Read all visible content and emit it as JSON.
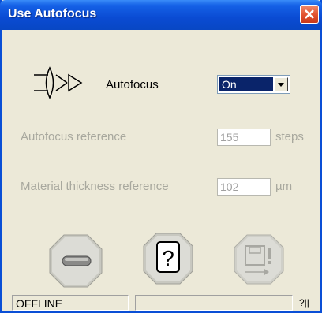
{
  "window": {
    "title": "Use Autofocus"
  },
  "autofocus": {
    "label": "Autofocus",
    "value": "On"
  },
  "reference": {
    "label": "Autofocus reference",
    "value": "155",
    "unit": "steps"
  },
  "thickness": {
    "label": "Material thickness reference",
    "value": "102",
    "unit": "µm"
  },
  "buttons": {
    "minus_icon": "minus-icon",
    "help_icon": "question-icon",
    "save_icon": "disk-icon"
  },
  "status": {
    "state": "OFFLINE",
    "message": "",
    "trailing": "?||"
  }
}
